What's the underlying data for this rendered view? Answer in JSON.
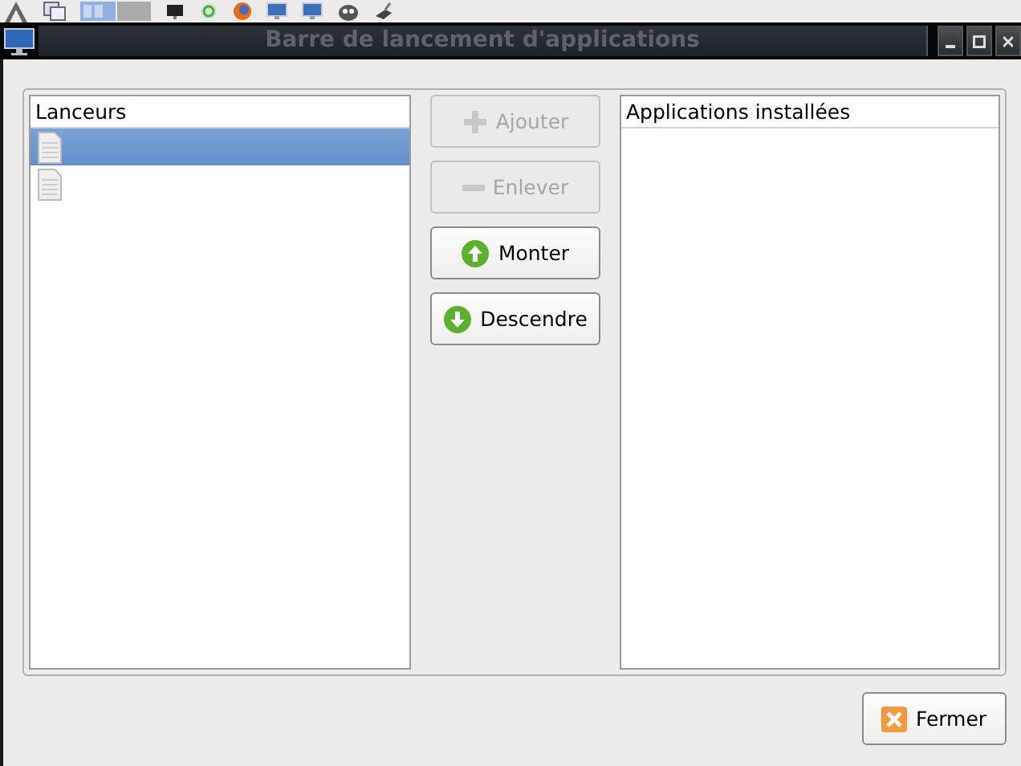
{
  "window": {
    "title": "Barre de lancement d'applications"
  },
  "launchers": {
    "header": "Lanceurs",
    "rows": [
      {
        "selected": true
      },
      {
        "selected": false
      }
    ]
  },
  "buttons": [
    {
      "label": "Ajouter",
      "kind": "add",
      "disabled": true
    },
    {
      "label": "Enlever",
      "kind": "remove",
      "disabled": true
    },
    {
      "label": "Monter",
      "kind": "up",
      "disabled": false
    },
    {
      "label": "Descendre",
      "kind": "down",
      "disabled": false
    }
  ],
  "installed": {
    "header": "Applications installées"
  },
  "close_button": {
    "label": "Fermer"
  }
}
